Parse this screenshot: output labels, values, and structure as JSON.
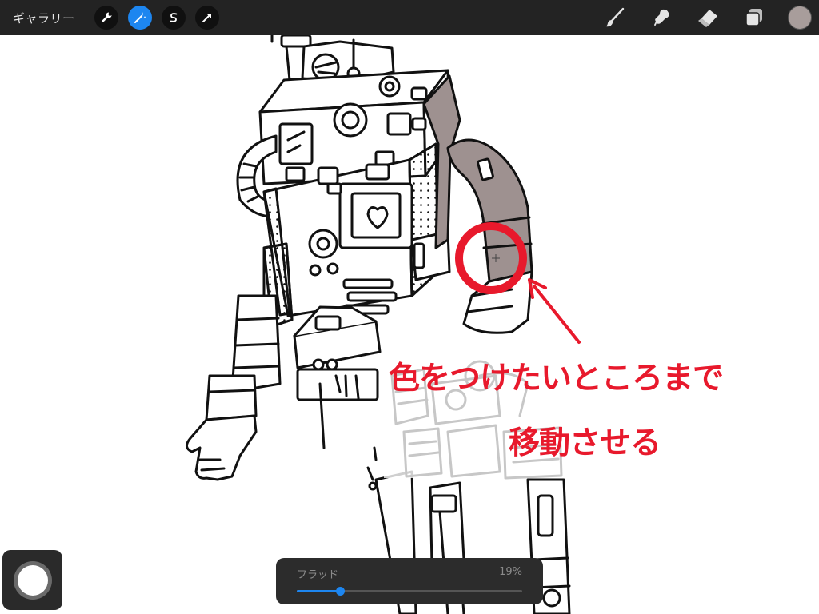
{
  "topbar": {
    "gallery_label": "ギャラリー",
    "tools": [
      {
        "name": "wrench-icon",
        "active": false
      },
      {
        "name": "magic-wand-icon",
        "active": true
      },
      {
        "name": "selection-s-icon",
        "active": false
      },
      {
        "name": "transform-arrow-icon",
        "active": false
      }
    ],
    "right_tools": [
      "brush-icon",
      "smudge-icon",
      "eraser-icon",
      "layers-icon"
    ],
    "current_color": "#a89d9b"
  },
  "annotation": {
    "line1": "色をつけたいところまで",
    "line2": "移動させる",
    "color": "#e8192c"
  },
  "slider": {
    "label": "フラッド",
    "value_text": "19%",
    "value": 0.19
  },
  "colors": {
    "toolbar_bg": "#232323",
    "accent": "#1d86f0",
    "fill_gray": "#9e9190"
  }
}
